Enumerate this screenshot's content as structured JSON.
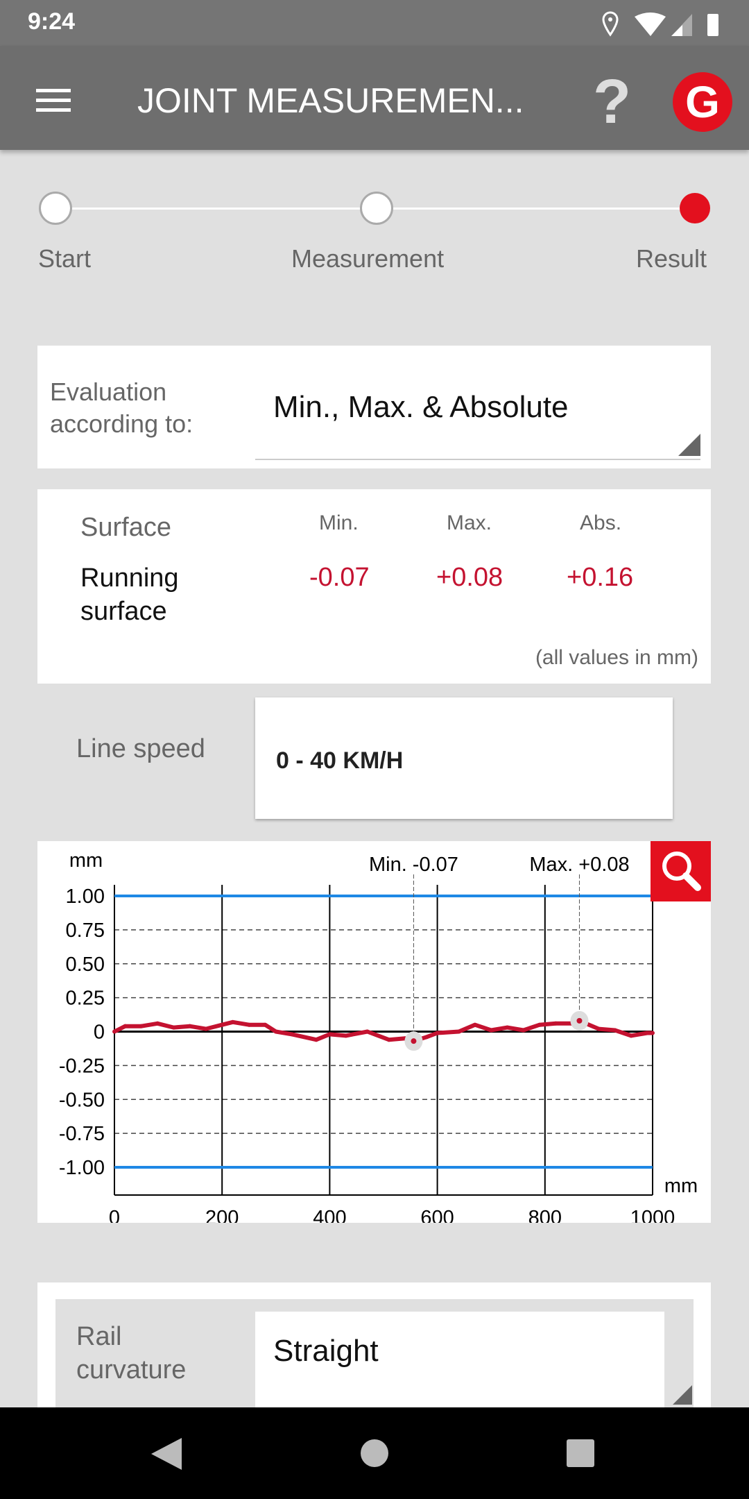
{
  "status_bar": {
    "time": "9:24",
    "icons": [
      "location-icon",
      "wifi-icon",
      "signal-icon",
      "battery-icon"
    ]
  },
  "app_bar": {
    "title": "JOINT MEASUREMEN...",
    "menu_icon": "hamburger-menu-icon",
    "help_icon": "question-mark-icon",
    "logo": "G"
  },
  "stepper": {
    "steps": [
      {
        "label": "Start",
        "state": "done"
      },
      {
        "label": "Measurement",
        "state": "done"
      },
      {
        "label": "Result",
        "state": "active"
      }
    ]
  },
  "evaluation": {
    "label": "Evaluation according to:",
    "value": "Min., Max. & Absolute"
  },
  "results": {
    "surface_header": "Surface",
    "min_header": "Min.",
    "max_header": "Max.",
    "abs_header": "Abs.",
    "surface": "Running surface",
    "min": "-0.07",
    "max": "+0.08",
    "abs": "+0.16",
    "unit_note": "(all values in mm)"
  },
  "line_speed": {
    "label": "Line speed",
    "value": "0 - 40 KM/H"
  },
  "chart_data": {
    "type": "line",
    "ylabel": "mm",
    "xlabel": "mm",
    "xlim": [
      0,
      1000
    ],
    "ylim": [
      -1,
      1
    ],
    "xticks": [
      "0",
      "200",
      "400",
      "600",
      "800",
      "1000"
    ],
    "yticks": [
      "1.00",
      "0.75",
      "0.50",
      "0.25",
      "0",
      "-0.25",
      "-0.50",
      "-0.75",
      "-1.00"
    ],
    "limits": [
      1.0,
      -1.0
    ],
    "limit_color": "#1e88e5",
    "series_color": "#c41230",
    "x": [
      0,
      20,
      50,
      80,
      110,
      140,
      170,
      200,
      220,
      250,
      280,
      300,
      330,
      375,
      400,
      430,
      470,
      510,
      540,
      556,
      580,
      600,
      640,
      670,
      700,
      730,
      760,
      790,
      820,
      850,
      864,
      900,
      930,
      960,
      990,
      1000
    ],
    "y": [
      0.0,
      0.04,
      0.04,
      0.06,
      0.03,
      0.04,
      0.02,
      0.05,
      0.07,
      0.05,
      0.05,
      0.0,
      -0.02,
      -0.06,
      -0.02,
      -0.03,
      0.0,
      -0.06,
      -0.05,
      -0.07,
      -0.04,
      -0.01,
      0.0,
      0.05,
      0.01,
      0.03,
      0.01,
      0.05,
      0.06,
      0.06,
      0.08,
      0.02,
      0.01,
      -0.03,
      -0.01,
      -0.01
    ],
    "annotations": [
      {
        "label": "Min. -0.07",
        "x": 556,
        "y": -0.07
      },
      {
        "label": "Max. +0.08",
        "x": 864,
        "y": 0.08
      }
    ],
    "zoom_icon": "magnifier-icon"
  },
  "rail_curvature": {
    "label": "Rail curvature",
    "value": "Straight"
  },
  "nav": {
    "back": "back-icon",
    "home": "home-icon",
    "recents": "recents-icon"
  }
}
